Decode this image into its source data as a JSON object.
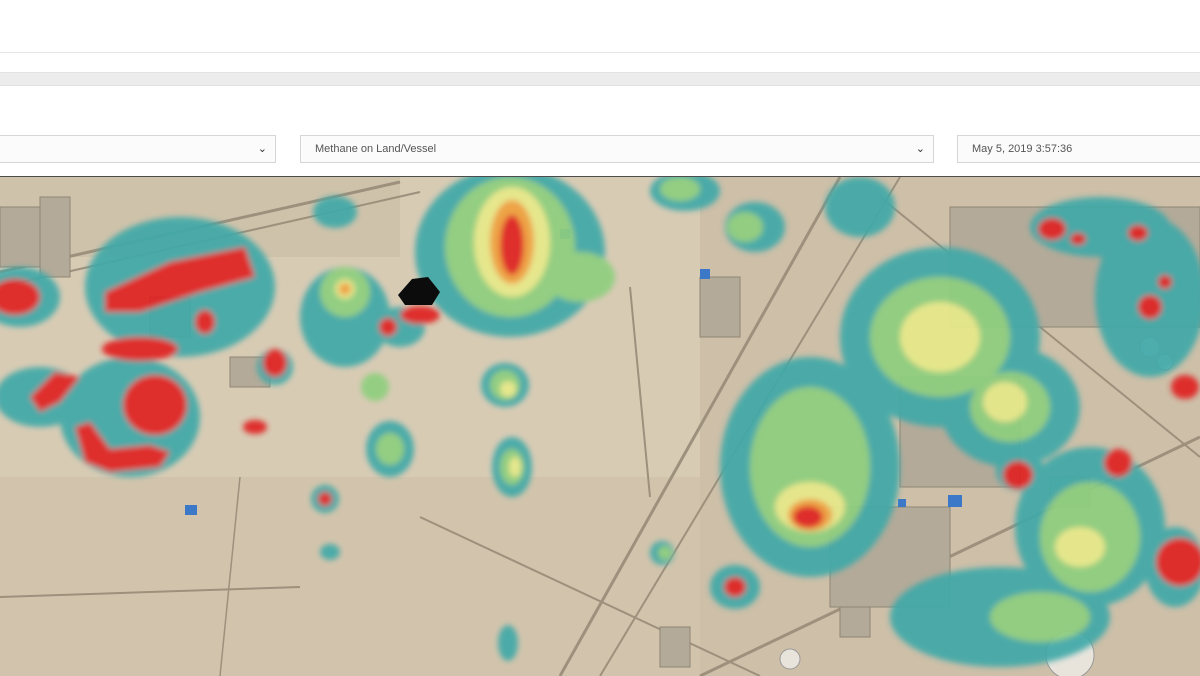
{
  "filters": {
    "first_select": {
      "value": ""
    },
    "gas_type_select": {
      "value": "Methane on Land/Vessel"
    },
    "timestamp_select": {
      "value": "May 5, 2019 3:57:36"
    }
  },
  "icons": {
    "dropdown": "chevron-down-icon"
  },
  "heatmap": {
    "legend_colors": {
      "low": "#3fa9a8",
      "low_mid": "#8ecf7e",
      "mid": "#e8ea8a",
      "high": "#f0a03c",
      "max": "#e02020"
    },
    "max_color": "#e02020"
  },
  "map_colors": {
    "sand": "#d6c8b0",
    "road": "#a89a86",
    "facility": "#bdb3a2"
  }
}
